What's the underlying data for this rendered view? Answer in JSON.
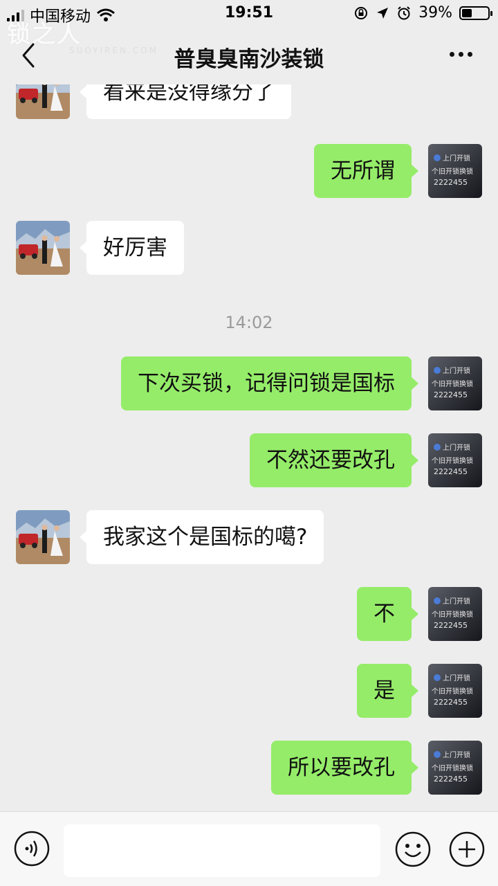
{
  "status_bar": {
    "carrier": "中国移动",
    "time": "19:51",
    "battery_percent": "39%",
    "battery_level": 0.39,
    "icons": [
      "signal-icon",
      "wifi-icon",
      "rotation-lock-icon",
      "location-icon",
      "alarm-icon",
      "battery-icon"
    ]
  },
  "watermark": {
    "text": "锁之人",
    "sub": "SUOYIREN.COM"
  },
  "nav": {
    "title": "普臭臭南沙装锁",
    "back_icon": "chevron-left-icon",
    "more_icon": "more-icon"
  },
  "own_avatar": {
    "line1": "上门开锁",
    "line2": "个旧开锁换锁",
    "line3": "2222455"
  },
  "messages": [
    {
      "side": "in",
      "text": "看来是没得缘分了"
    },
    {
      "side": "out",
      "text": "无所谓"
    },
    {
      "side": "in",
      "text": "好厉害"
    },
    {
      "side": "time",
      "text": "14:02"
    },
    {
      "side": "out",
      "text": "下次买锁，记得问锁是国标"
    },
    {
      "side": "out",
      "text": "不然还要改孔"
    },
    {
      "side": "in",
      "text": "我家这个是国标的噶?"
    },
    {
      "side": "out",
      "text": "不"
    },
    {
      "side": "out",
      "text": "是"
    },
    {
      "side": "out",
      "text": "所以要改孔"
    }
  ],
  "input_bar": {
    "input_value": "",
    "icons": [
      "voice-icon",
      "emoji-icon",
      "plus-icon"
    ]
  },
  "colors": {
    "background": "#ededed",
    "outgoing_bubble": "#95ec69",
    "incoming_bubble": "#ffffff"
  }
}
